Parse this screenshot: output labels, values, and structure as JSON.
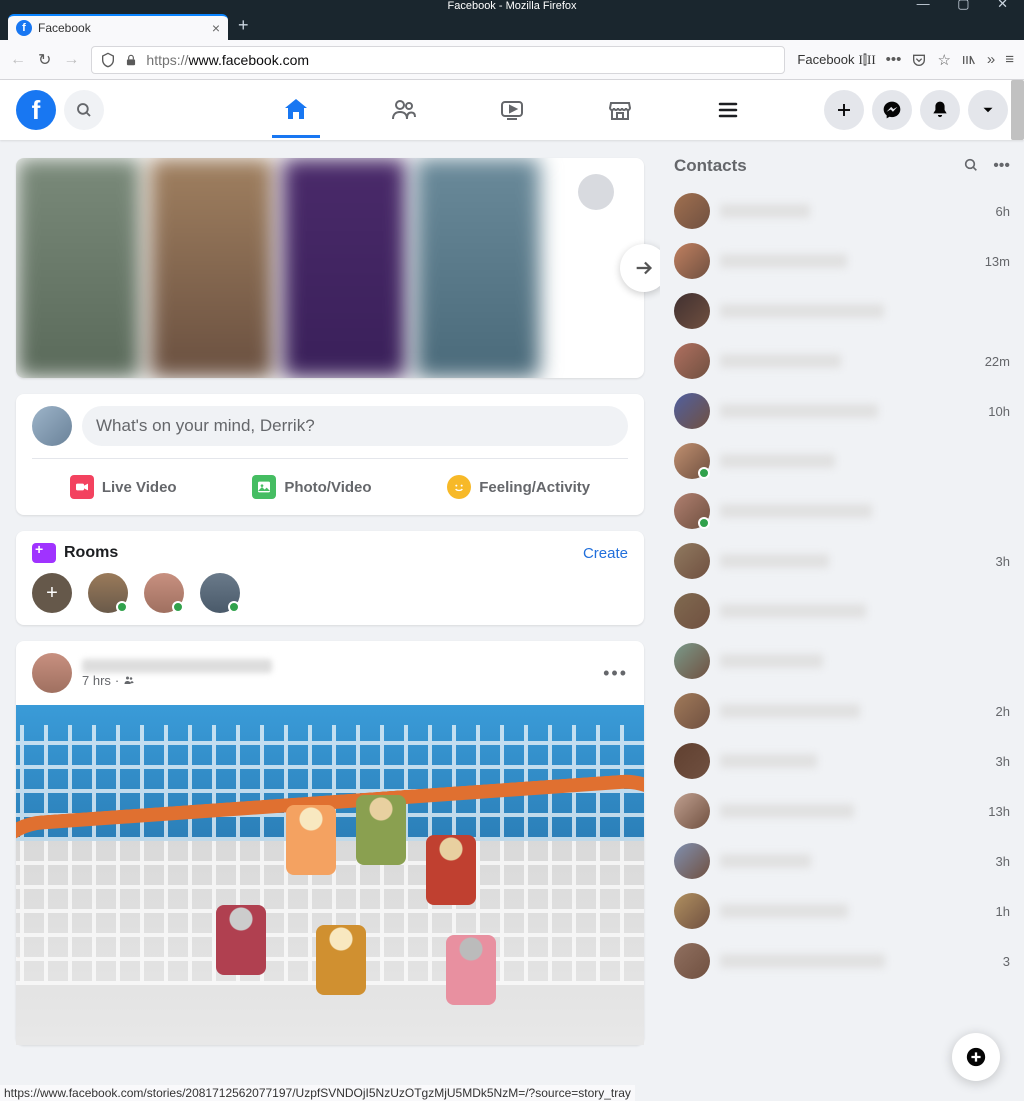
{
  "window": {
    "title": "Facebook - Mozilla Firefox"
  },
  "tab": {
    "title": "Facebook"
  },
  "url": {
    "protocol": "https://",
    "domain": "www.facebook.com",
    "readmode": "Facebook"
  },
  "composer": {
    "placeholder": "What's on your mind, Derrik?",
    "live_video": "Live Video",
    "photo_video": "Photo/Video",
    "feeling": "Feeling/Activity"
  },
  "rooms": {
    "title": "Rooms",
    "create": "Create"
  },
  "post": {
    "time": "7 hrs"
  },
  "contacts": {
    "title": "Contacts",
    "items": [
      {
        "time": "6h"
      },
      {
        "time": "13m"
      },
      {
        "time": ""
      },
      {
        "time": "22m"
      },
      {
        "time": "10h"
      },
      {
        "time": "",
        "online": true
      },
      {
        "time": "",
        "online": true
      },
      {
        "time": "3h"
      },
      {
        "time": ""
      },
      {
        "time": ""
      },
      {
        "time": "2h"
      },
      {
        "time": "3h"
      },
      {
        "time": "13h"
      },
      {
        "time": "3h"
      },
      {
        "time": "1h"
      },
      {
        "time": "3"
      }
    ]
  },
  "status": "https://www.facebook.com/stories/2081712562077197/UzpfSVNDOjI5NzUzOTgzMjU5MDk5NzM=/?source=story_tray"
}
